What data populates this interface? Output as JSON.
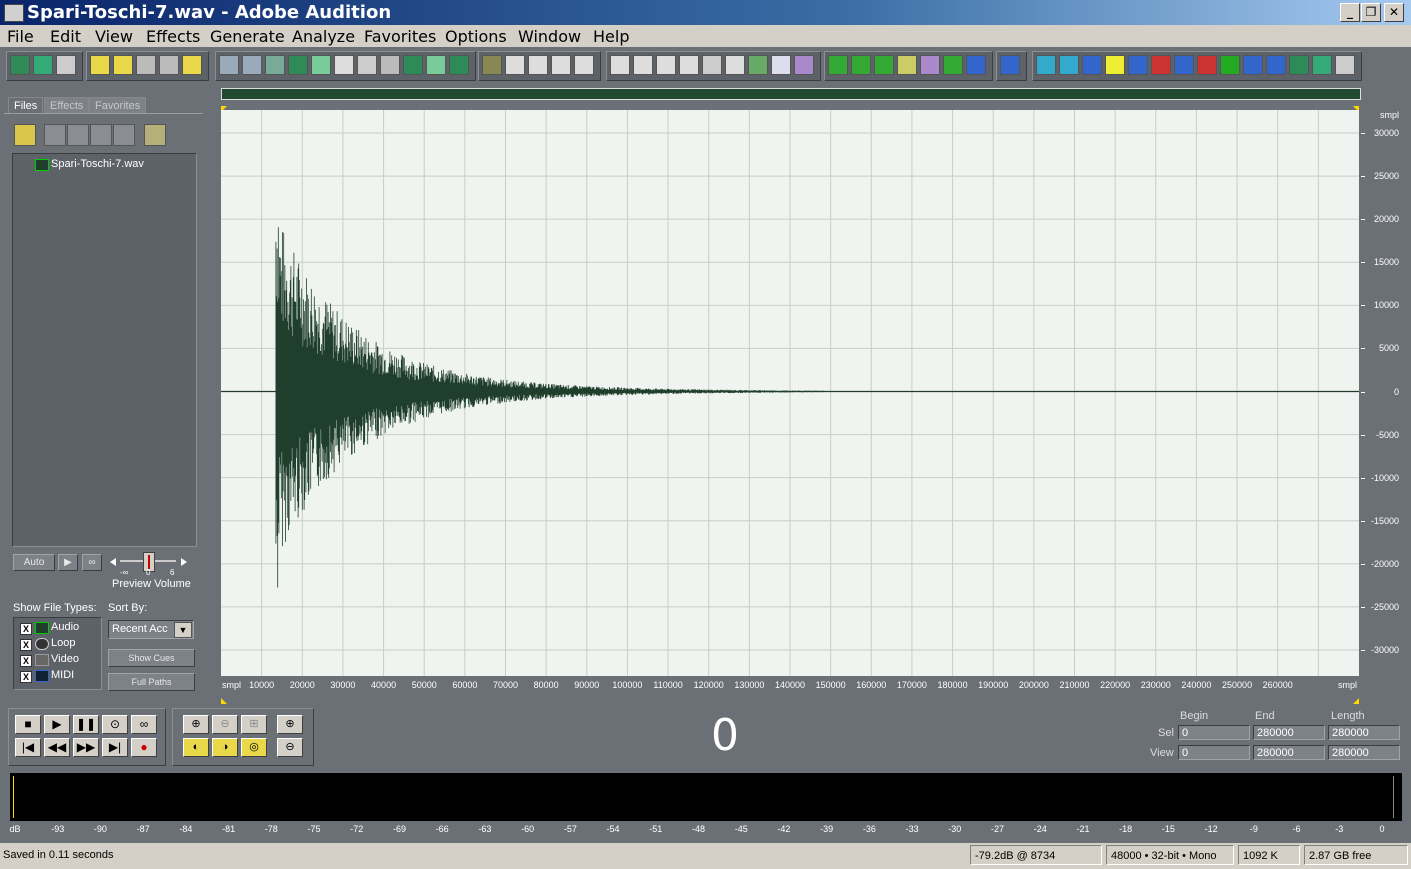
{
  "window": {
    "title": "Spari-Toschi-7.wav - Adobe Audition"
  },
  "menu": [
    "File",
    "Edit",
    "View",
    "Effects",
    "Generate",
    "Analyze",
    "Favorites",
    "Options",
    "Window",
    "Help"
  ],
  "toolbar_icons": [
    "waveform-view-icon",
    "multitrack-view-icon",
    "cd-view-icon",
    "new-file-icon",
    "open-file-icon",
    "save-icon",
    "save-all-icon",
    "save-selection-icon",
    "undo-icon",
    "redo-icon",
    "repeat-icon",
    "select-all-icon",
    "copy-icon",
    "cut-icon",
    "paste-icon",
    "paste-new-icon",
    "mix-paste-icon",
    "trim-icon",
    "snap-icon",
    "envelope-icon",
    "marker-icon",
    "cue-list-icon",
    "playlist-icon",
    "info-icon",
    "frequency-icon",
    "play-icon",
    "zoom-icon",
    "time-icon",
    "bits-icon",
    "spectral-icon",
    "pan-icon",
    "fx-icon",
    "fir-icon",
    "filter-icon",
    "graphic-eq-icon",
    "noise-icon",
    "amplify-icon",
    "normalize-icon",
    "analyze-icon",
    "ap-icon",
    "ap42-icon",
    "mq-icon",
    "vprp-icon",
    "crossfade-icon",
    "delay-icon",
    "reverb-icon",
    "spectrum-icon",
    "bars-icon",
    "phase-icon",
    "itu-p56-icon",
    "sti-icon",
    "export-icon"
  ],
  "left_panel": {
    "tabs": [
      "Files",
      "Effects",
      "Favorites"
    ],
    "files": [
      "Spari-Toschi-7.wav"
    ],
    "auto_label": "Auto",
    "preview_volume_label": "Preview Volume",
    "preview_volume_min": "-∞",
    "preview_volume_mid": "0",
    "preview_volume_max": "6",
    "show_file_types_label": "Show File Types:",
    "sort_by_label": "Sort By:",
    "file_types": [
      {
        "label": "Audio",
        "checked": "X"
      },
      {
        "label": "Loop",
        "checked": "X"
      },
      {
        "label": "Video",
        "checked": "X"
      },
      {
        "label": "MIDI",
        "checked": "X"
      }
    ],
    "sort_value": "Recent Acc",
    "show_cues_label": "Show Cues",
    "full_paths_label": "Full Paths"
  },
  "waveform": {
    "y_unit": "smpl",
    "y_ticks": [
      "30000",
      "25000",
      "20000",
      "15000",
      "10000",
      "5000",
      "0",
      "-5000",
      "-10000",
      "-15000",
      "-20000",
      "-25000",
      "-30000"
    ],
    "x_unit_left": "smpl",
    "x_unit_right": "smpl",
    "x_ticks": [
      "10000",
      "20000",
      "30000",
      "40000",
      "50000",
      "60000",
      "70000",
      "80000",
      "90000",
      "100000",
      "110000",
      "120000",
      "130000",
      "140000",
      "150000",
      "160000",
      "170000",
      "180000",
      "190000",
      "200000",
      "210000",
      "220000",
      "230000",
      "240000",
      "250000",
      "260000"
    ],
    "wave_color": "#1f3f2c",
    "bg_color": "#f0f4f1"
  },
  "transport": {
    "time": "0",
    "begin_label": "Begin",
    "end_label": "End",
    "length_label": "Length",
    "sel_label": "Sel",
    "view_label": "View",
    "sel_begin": "0",
    "sel_end": "280000",
    "sel_length": "280000",
    "view_begin": "0",
    "view_end": "280000",
    "view_length": "280000"
  },
  "meter": {
    "ticks": [
      "dB",
      "-93",
      "-90",
      "-87",
      "-84",
      "-81",
      "-78",
      "-75",
      "-72",
      "-69",
      "-66",
      "-63",
      "-60",
      "-57",
      "-54",
      "-51",
      "-48",
      "-45",
      "-42",
      "-39",
      "-36",
      "-33",
      "-30",
      "-27",
      "-24",
      "-21",
      "-18",
      "-15",
      "-12",
      "-9",
      "-6",
      "-3",
      "0"
    ]
  },
  "status": {
    "message": "Saved in 0.11 seconds",
    "level": "-79.2dB @ 8734",
    "format": "48000 • 32-bit • Mono",
    "size": "1092 K",
    "free": "2.87 GB free"
  }
}
